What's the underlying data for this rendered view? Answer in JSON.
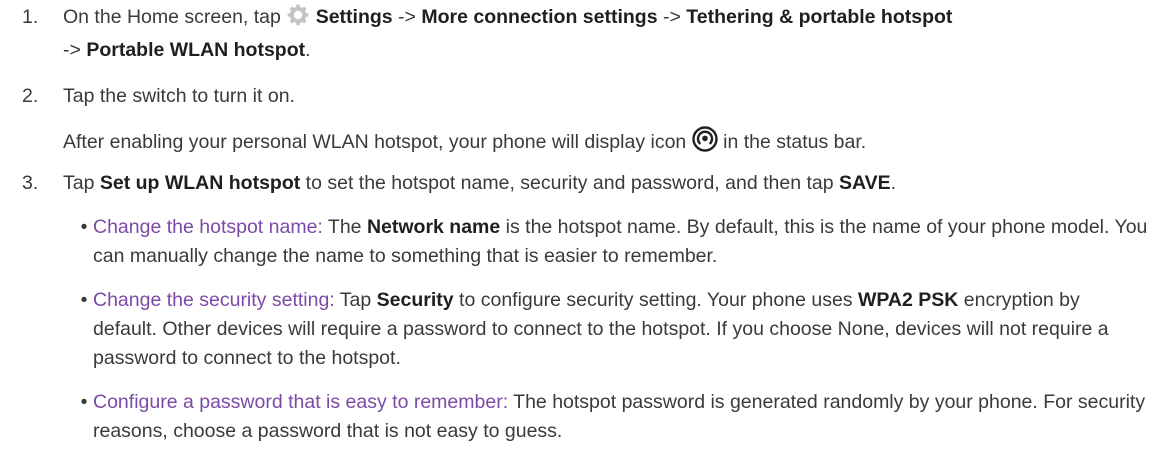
{
  "steps": [
    {
      "number": "1.",
      "parts": {
        "a": "On the Home screen, tap ",
        "b_settings": "Settings",
        "c": " -> ",
        "d_more": "More connection settings",
        "e": " -> ",
        "f_tether": "Tethering & portable hotspot",
        "g": " -> ",
        "h_portable": "Portable WLAN hotspot",
        "i": "."
      }
    },
    {
      "number": "2.",
      "text": "Tap the switch to turn it on.",
      "sub_a": "After enabling your personal WLAN hotspot, your phone will display icon ",
      "sub_b": " in the status bar."
    },
    {
      "number": "3.",
      "parts": {
        "a": "Tap ",
        "b_setup": "Set up WLAN hotspot",
        "c": " to set the hotspot name, security and password, and then tap ",
        "d_save": "SAVE",
        "e": "."
      }
    }
  ],
  "bullets": [
    {
      "lead": "Change the hotspot name:",
      "a": " The ",
      "b_network": "Network name",
      "c": " is the hotspot name. By default, this is the name of your phone model. You can manually change the name to something that is easier to remember."
    },
    {
      "lead": "Change the security setting:",
      "a": " Tap ",
      "b_security": "Security",
      "c": " to configure security setting. Your phone uses ",
      "d_wpa": "WPA2 PSK",
      "e": " encryption by default. Other devices will require a password to connect to the hotspot. If you choose None, devices will not require a password to connect to the hotspot."
    },
    {
      "lead": "Configure a password that is easy to remember:",
      "a": " The hotspot password is generated randomly by your phone. For security reasons, choose a password that is not easy to guess."
    }
  ],
  "bullet_glyph": "•",
  "icons": {
    "settings": "gear-icon",
    "hotspot": "hotspot-status-icon"
  },
  "colors": {
    "text": "#3a3a3a",
    "bold": "#1f1f1f",
    "lead": "#7b4aa6",
    "gear": "#b5b5b5"
  }
}
